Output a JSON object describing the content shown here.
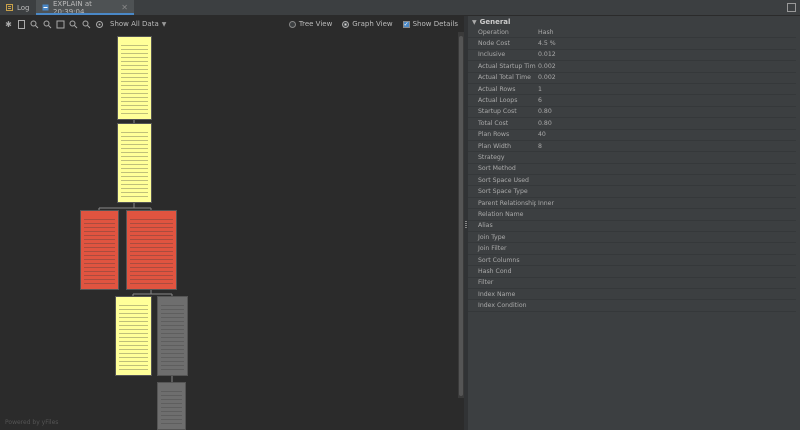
{
  "tabs": [
    {
      "label": "Log",
      "icon": "log-icon"
    },
    {
      "label": "EXPLAIN at 20:39:04",
      "icon": "explain-icon",
      "active": true
    }
  ],
  "toolbar": {
    "icons": [
      "pin-icon",
      "export-icon",
      "zoom-in-icon",
      "zoom-out-icon",
      "fit-icon",
      "zoom-reset-icon",
      "zoom-actual-icon",
      "settings-icon"
    ],
    "show_all_label": "Show All Data",
    "tree_view_label": "Tree View",
    "graph_view_label": "Graph View",
    "show_details_label": "Show Details",
    "selected_view": "Graph View",
    "show_details_checked": true
  },
  "graph": {
    "powered_by": "Powered by yFiles",
    "node_colors": {
      "yellow": "#ffff99",
      "red": "#e05440",
      "gray": "#6e6e6e"
    }
  },
  "properties": {
    "section_title": "General",
    "rows": [
      {
        "name": "Operation",
        "value": "Hash"
      },
      {
        "name": "Node Cost",
        "value": "4.5 %"
      },
      {
        "name": "Inclusive",
        "value": "0.012"
      },
      {
        "name": "Actual Startup Time",
        "value": "0.002"
      },
      {
        "name": "Actual Total Time",
        "value": "0.002"
      },
      {
        "name": "Actual Rows",
        "value": "1"
      },
      {
        "name": "Actual Loops",
        "value": "6"
      },
      {
        "name": "Startup Cost",
        "value": "0.80"
      },
      {
        "name": "Total Cost",
        "value": "0.80"
      },
      {
        "name": "Plan Rows",
        "value": "40"
      },
      {
        "name": "Plan Width",
        "value": "8"
      },
      {
        "name": "Strategy",
        "value": ""
      },
      {
        "name": "Sort Method",
        "value": ""
      },
      {
        "name": "Sort Space Used",
        "value": ""
      },
      {
        "name": "Sort Space Type",
        "value": ""
      },
      {
        "name": "Parent Relationship",
        "value": "Inner"
      },
      {
        "name": "Relation Name",
        "value": ""
      },
      {
        "name": "Alias",
        "value": ""
      },
      {
        "name": "Join Type",
        "value": ""
      },
      {
        "name": "Join Filter",
        "value": ""
      },
      {
        "name": "Sort Columns",
        "value": ""
      },
      {
        "name": "Hash Cond",
        "value": ""
      },
      {
        "name": "Filter",
        "value": ""
      },
      {
        "name": "Index Name",
        "value": ""
      },
      {
        "name": "Index Condition",
        "value": ""
      }
    ]
  }
}
